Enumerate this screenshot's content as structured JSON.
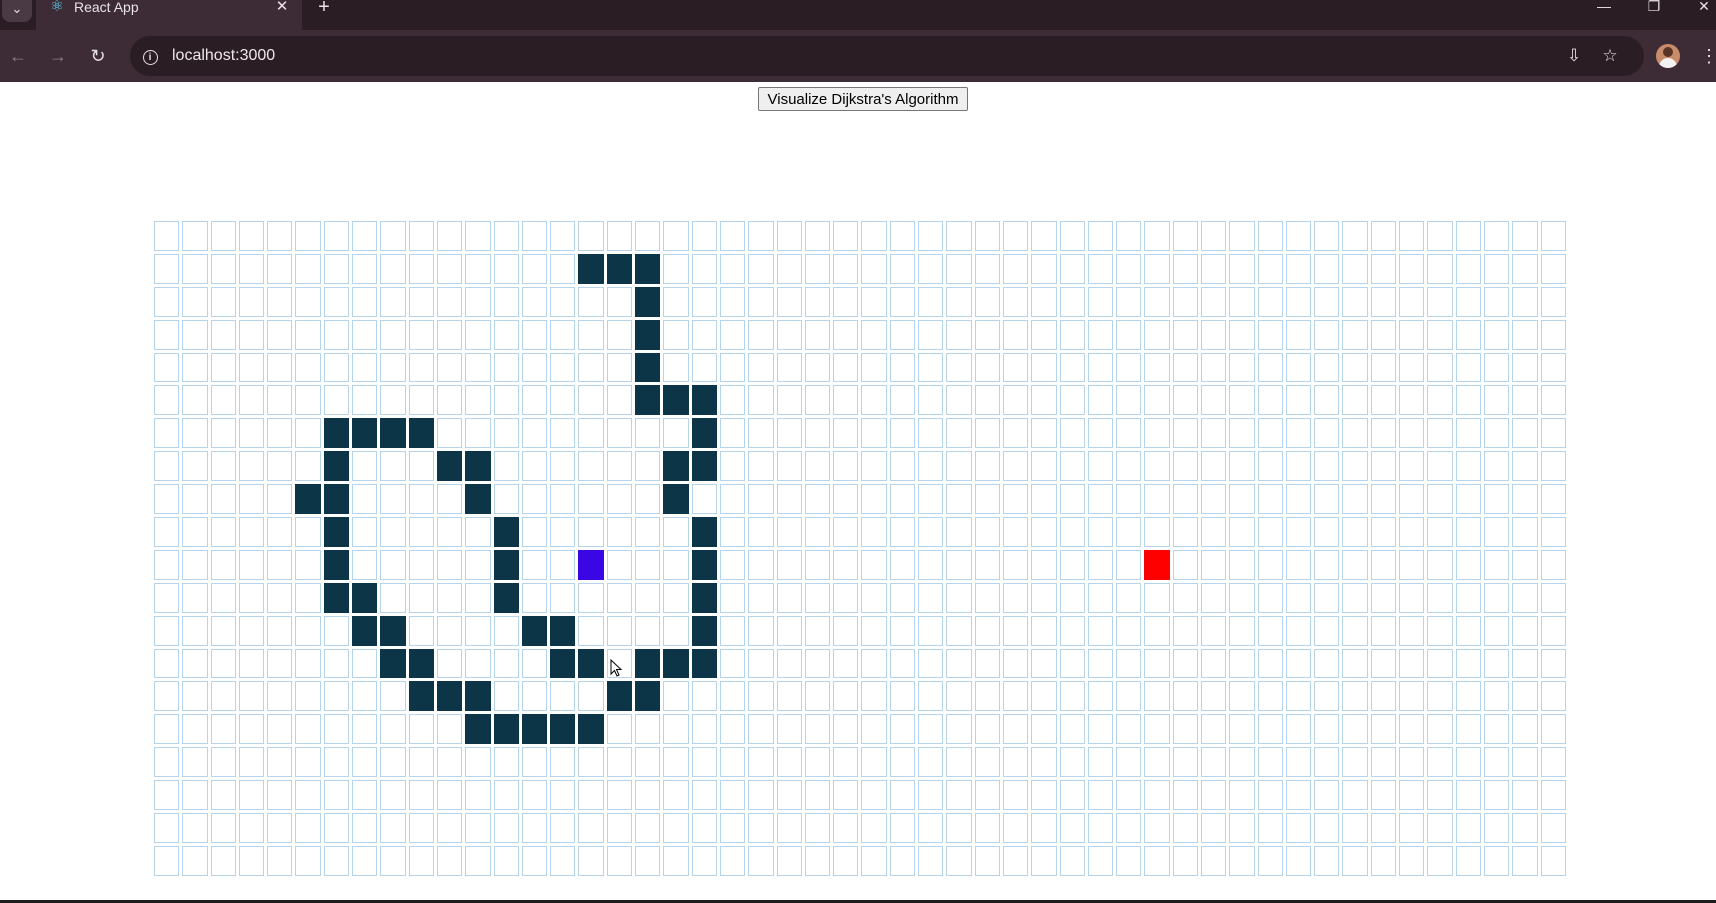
{
  "browser": {
    "tab": {
      "title": "React App",
      "favicon_icon": "react-logo-icon",
      "close_glyph": "✕"
    },
    "new_tab_glyph": "+",
    "tab_search_glyph": "⌄",
    "window_controls": {
      "minimize": "—",
      "restore": "❐",
      "close": "✕"
    },
    "nav": {
      "back": "←",
      "forward": "→",
      "reload": "↻"
    },
    "address_bar": {
      "url": "localhost:3000",
      "site_info_glyph": "i"
    },
    "toolbar_icons": {
      "install": "⇩",
      "bookmark": "☆",
      "menu": "⋮"
    }
  },
  "app": {
    "visualize_button_label": "Visualize Dijkstra's Algorithm",
    "grid": {
      "rows": 20,
      "cols": 50,
      "start": [
        10,
        15
      ],
      "finish": [
        10,
        35
      ],
      "walls": [
        [
          1,
          15
        ],
        [
          1,
          16
        ],
        [
          1,
          17
        ],
        [
          2,
          17
        ],
        [
          3,
          17
        ],
        [
          4,
          17
        ],
        [
          5,
          17
        ],
        [
          5,
          18
        ],
        [
          5,
          19
        ],
        [
          6,
          6
        ],
        [
          6,
          7
        ],
        [
          6,
          8
        ],
        [
          6,
          9
        ],
        [
          6,
          19
        ],
        [
          7,
          6
        ],
        [
          7,
          10
        ],
        [
          7,
          11
        ],
        [
          7,
          18
        ],
        [
          7,
          19
        ],
        [
          8,
          5
        ],
        [
          8,
          6
        ],
        [
          8,
          11
        ],
        [
          8,
          18
        ],
        [
          9,
          6
        ],
        [
          9,
          12
        ],
        [
          9,
          19
        ],
        [
          10,
          6
        ],
        [
          10,
          12
        ],
        [
          10,
          19
        ],
        [
          11,
          6
        ],
        [
          11,
          7
        ],
        [
          11,
          12
        ],
        [
          11,
          19
        ],
        [
          12,
          7
        ],
        [
          12,
          8
        ],
        [
          12,
          13
        ],
        [
          12,
          14
        ],
        [
          12,
          19
        ],
        [
          13,
          8
        ],
        [
          13,
          9
        ],
        [
          13,
          14
        ],
        [
          13,
          15
        ],
        [
          13,
          17
        ],
        [
          13,
          18
        ],
        [
          13,
          19
        ],
        [
          14,
          9
        ],
        [
          14,
          10
        ],
        [
          14,
          11
        ],
        [
          14,
          16
        ],
        [
          14,
          17
        ],
        [
          15,
          11
        ],
        [
          15,
          12
        ],
        [
          15,
          13
        ],
        [
          15,
          14
        ],
        [
          15,
          15
        ]
      ]
    },
    "colors": {
      "wall": "#0c3547",
      "start": "#3a07e4",
      "finish": "#ff0000",
      "cell_border": "#b5d3ea"
    }
  }
}
